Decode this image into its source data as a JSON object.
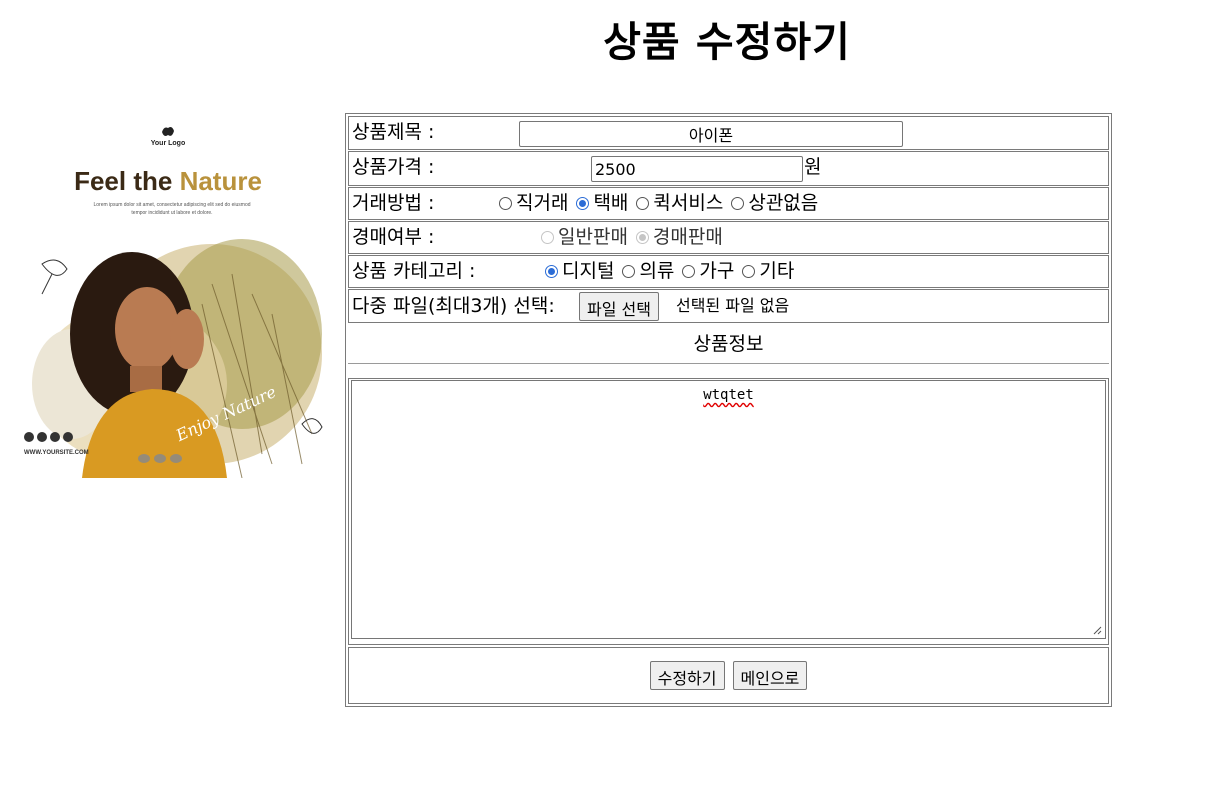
{
  "page": {
    "title": "상품 수정하기"
  },
  "promo": {
    "logo_text": "Your Logo",
    "headline_part1": "Feel the ",
    "headline_part2": "Nature",
    "body_line1": "Lorem ipsum dolor sit amet, consectetur adipiscing elit sed do eiusmod",
    "body_line2": "tempor incididunt ut labore et dolore.",
    "script_text": "Enjoy Nature",
    "website": "WWW.YOURSITE.COM"
  },
  "form": {
    "title_label": "상품제목 :",
    "title_value": "아이폰",
    "price_label": "상품가격 :",
    "price_value": "2500",
    "price_unit": "원",
    "trade_label": "거래방법 :",
    "trade_options": [
      {
        "label": "직거래",
        "checked": false
      },
      {
        "label": "택배",
        "checked": true
      },
      {
        "label": "퀵서비스",
        "checked": false
      },
      {
        "label": "상관없음",
        "checked": false
      }
    ],
    "auction_label": "경매여부 :",
    "auction_options": [
      {
        "label": "일반판매",
        "checked": false,
        "disabled": true
      },
      {
        "label": "경매판매",
        "checked": true,
        "disabled": true
      }
    ],
    "category_label": "상품 카테고리 :",
    "category_options": [
      {
        "label": "디지털",
        "checked": true
      },
      {
        "label": "의류",
        "checked": false
      },
      {
        "label": "가구",
        "checked": false
      },
      {
        "label": "기타",
        "checked": false
      }
    ],
    "file_label": "다중 파일(최대3개) 선택:",
    "file_button": "파일 선택",
    "file_status": "선택된 파일 없음",
    "info_heading": "상품정보",
    "description": "wtqtet",
    "submit_button": "수정하기",
    "main_button": "메인으로"
  },
  "colors": {
    "radio_checked": "#2b6cd6",
    "spell_underline": "#e00000"
  }
}
